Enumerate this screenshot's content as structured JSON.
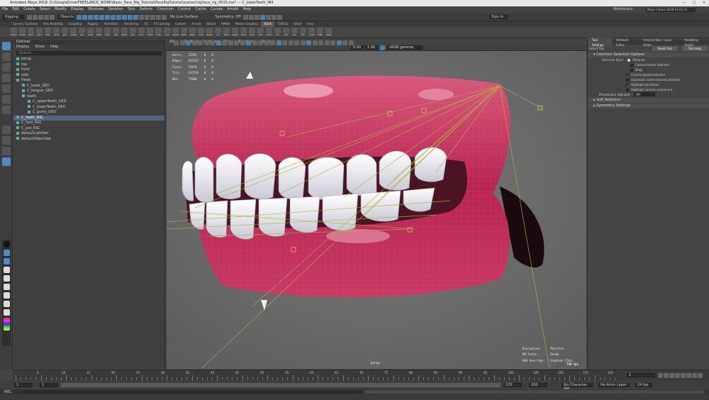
{
  "window": {
    "title": "Autodesk Maya 2018: D:\\GoogleDrive\\FREELANCE_WORK\\Basic_Face_Rig_Tutorial\\FaceRigTutorial\\scenes\\rig\\face_rig_0015.ma* --- C_lowerTeeth_IN4",
    "controls": [
      "—",
      "□",
      "✕"
    ]
  },
  "menubar": [
    "File",
    "Edit",
    "Create",
    "Select",
    "Modify",
    "Display",
    "Windows",
    "Skeleton",
    "Skin",
    "Deform",
    "Constrain",
    "Control",
    "Cache",
    "Curves",
    "Arnold",
    "Help"
  ],
  "workspace": {
    "label": "Workspace:",
    "value": "Maya Classic 2018.01.01.01"
  },
  "statusline": {
    "mode": "Rigging",
    "objects_label": "Objects",
    "no_live_surface": "No Live Surface",
    "symmetry": "Symmetry: Off",
    "sign_in": "Sign In"
  },
  "shelf_tabs": [
    "Curves / Surfaces",
    "Poly Modeling",
    "Sculpting",
    "Rigging",
    "Animation",
    "Rendering",
    "FX",
    "FX Caching",
    "Custom",
    "Arnold",
    "Bifrost",
    "MASH",
    "Motion Graphics",
    "XGen",
    "TURTLE",
    "SOuP",
    "Vray"
  ],
  "shelf_active": "XGen",
  "shelf_items": [
    "MASH",
    "SHAD",
    "DISP",
    "CRVS",
    "PINS",
    "ATTR",
    "JNT",
    "CONS",
    "RIG",
    "SKIN",
    "BIND",
    "WGT",
    "FRZ",
    "PRNT",
    "DLT",
    "HIST",
    "CNTR",
    "CTRL",
    "GRP",
    "NAME",
    "ZERO",
    "MIRR",
    "CLST",
    "BLND",
    "LAT",
    "WIRE",
    "WRAP",
    "SCLP",
    "FOLL",
    "LOC",
    "HELP",
    "PIV",
    "SET",
    "SEL",
    "KEY",
    "CLNP",
    "TIME",
    "ANIM"
  ],
  "outliner": {
    "title": "Outliner",
    "menu": [
      "Display",
      "Show",
      "Help"
    ],
    "search_placeholder": "Search...",
    "items": [
      {
        "label": "persp",
        "indent": 0,
        "selected": false
      },
      {
        "label": "top",
        "indent": 0,
        "selected": false
      },
      {
        "label": "front",
        "indent": 0,
        "selected": false
      },
      {
        "label": "side",
        "indent": 0,
        "selected": false
      },
      {
        "label": "Head",
        "indent": 0,
        "selected": false
      },
      {
        "label": "C_head_GEO",
        "indent": 1,
        "selected": false
      },
      {
        "label": "C_tongue_GEO",
        "indent": 1,
        "selected": false
      },
      {
        "label": "teeth",
        "indent": 1,
        "selected": false
      },
      {
        "label": "C_upperTeeth_GEO",
        "indent": 2,
        "selected": false
      },
      {
        "label": "C_lowerTeeth_GEO",
        "indent": 2,
        "selected": false
      },
      {
        "label": "C_gums_GEO",
        "indent": 2,
        "selected": false
      },
      {
        "label": "C_teeth_RIG",
        "indent": 0,
        "selected": true
      },
      {
        "label": "C_face_RIG",
        "indent": 0,
        "selected": false
      },
      {
        "label": "C_jaw_RIG",
        "indent": 0,
        "selected": false
      },
      {
        "label": "defaultLightSet",
        "indent": 0,
        "selected": false
      },
      {
        "label": "defaultObjectSet",
        "indent": 0,
        "selected": false
      }
    ]
  },
  "viewport": {
    "menu": [
      "View",
      "Shading",
      "Lighting",
      "Show",
      "Renderer",
      "Panels"
    ],
    "fields": {
      "near": "0.00",
      "far": "1.00",
      "color_space": "sRGB gamma"
    },
    "hud_stats": [
      {
        "label": "Verts:",
        "v1": "73765",
        "v2": "0",
        "v3": "0"
      },
      {
        "label": "Edges:",
        "v1": "147247",
        "v2": "0",
        "v3": "0"
      },
      {
        "label": "Faces:",
        "v1": "73478",
        "v2": "0",
        "v3": "0"
      },
      {
        "label": "Tris:",
        "v1": "147319",
        "v2": "0",
        "v3": "0"
      },
      {
        "label": "UVs:",
        "v1": "77000",
        "v2": "0",
        "v3": "0"
      }
    ],
    "hud_eval": [
      {
        "label": "Evaluation:",
        "value": "Parallel"
      },
      {
        "label": "EM State:",
        "value": "Ready"
      },
      {
        "label": "GPU Override:",
        "value": "Enabled (73k)"
      }
    ],
    "fps": "740 fps",
    "camera": "persp"
  },
  "right_panel": {
    "tabs": [
      "Tool Settings",
      "Attribute Editor",
      "Channel Box / Layer Editor",
      "Modelling Toolkit"
    ],
    "tool_name": "Select Tool",
    "reset_label": "Reset Tool",
    "help_label": "Tool Help",
    "sections": {
      "common": "Common Selection Options",
      "soft": "Soft Selection",
      "symmetry": "Symmetry Settings"
    },
    "selection_style_label": "Selection Style:",
    "selection_style_value": "Marquee",
    "options": [
      {
        "label": "Camera based selection",
        "checked": false
      },
      {
        "label": "Drag",
        "checked": false
      },
      {
        "label": "Camera based selection",
        "checked": true
      },
      {
        "label": "Automatic camera-based selection",
        "checked": false
      },
      {
        "label": "Highlight backfaces",
        "checked": true
      },
      {
        "label": "Highlight nearest component",
        "checked": false
      }
    ],
    "preselect_label": "Preselection Highlight",
    "preselect_value": "Off"
  },
  "timeline": {
    "ticks": [
      "5",
      "10",
      "15",
      "20",
      "25",
      "30",
      "35",
      "40",
      "45",
      "50",
      "55",
      "60",
      "65",
      "70",
      "75",
      "80",
      "85",
      "90",
      "95",
      "100",
      "105",
      "110",
      "115",
      "120"
    ],
    "current_frame": "1",
    "start": "1",
    "end": "120",
    "range_start": "1",
    "range_end": "120",
    "anim_end": "200",
    "char_set": "No Character Set",
    "anim_layer": "No Anim Layer",
    "fps_setting": "24 fps"
  },
  "cmd": {
    "language": "MEL"
  },
  "colors": {
    "selection": "#506680",
    "accent": "#5189c4",
    "wire": "#b0b040"
  }
}
